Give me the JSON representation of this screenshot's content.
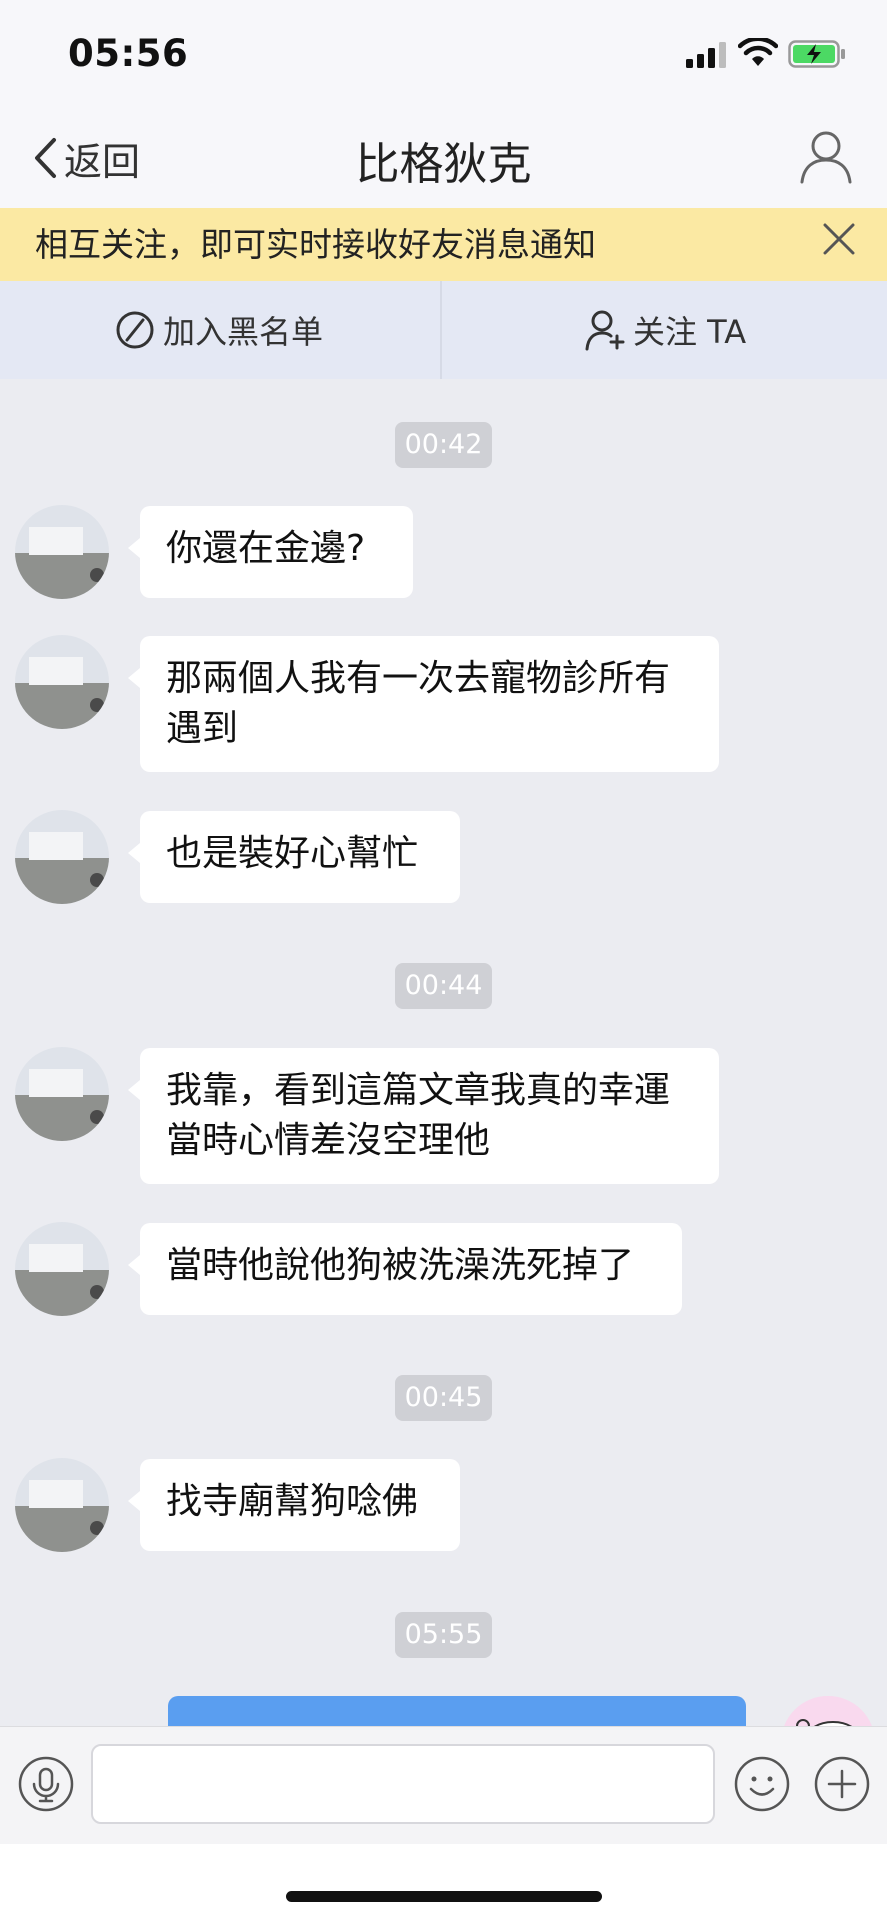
{
  "status_bar": {
    "time": "05:56"
  },
  "nav": {
    "back_label": "返回",
    "title": "比格狄克"
  },
  "notice": {
    "text": "相互关注，即可实时接收好友消息通知"
  },
  "actions": {
    "block_label": "加入黑名单",
    "follow_label": "关注 TA"
  },
  "messages": [
    {
      "type": "time",
      "text": "00:42"
    },
    {
      "type": "received",
      "text": "你還在金邊?"
    },
    {
      "type": "received",
      "line1": "那兩個人我有一次去寵物診所有",
      "line2": "遇到"
    },
    {
      "type": "received",
      "text": "也是裝好心幫忙"
    },
    {
      "type": "time",
      "text": "00:44"
    },
    {
      "type": "received",
      "line1": "我靠，看到這篇文章我真的幸運",
      "line2": "當時心情差沒空理他"
    },
    {
      "type": "received",
      "text": "當時他說他狗被洗澡洗死掉了"
    },
    {
      "type": "time",
      "text": "00:45"
    },
    {
      "type": "received",
      "text": "找寺廟幫狗唸佛"
    },
    {
      "type": "time",
      "text": "05:55"
    }
  ],
  "input": {
    "placeholder": ""
  },
  "colors": {
    "notice_bg": "#fbe9a3",
    "sent_bubble": "#5a9ef0",
    "chat_bg": "#ebecf1"
  }
}
